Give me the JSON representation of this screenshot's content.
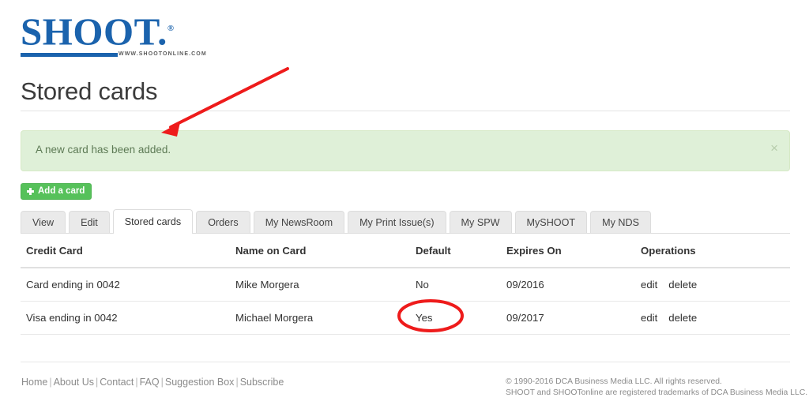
{
  "logo": {
    "wordmark": "SHOOT.",
    "registered_mark": "®",
    "url_text": "WWW.SHOOTONLINE.COM",
    "brand_color": "#1b63ad"
  },
  "page_title": "Stored cards",
  "alert": {
    "message": "A new card has been added.",
    "close_label": "×",
    "background_color": "#dff0d8",
    "border_color": "#d6e9c6",
    "text_color": "#5d7a55"
  },
  "actions": {
    "add_card_label": "Add a card",
    "add_card_icon": "plus-icon",
    "add_card_color": "#56c15a"
  },
  "tabs": [
    {
      "label": "View",
      "active": false
    },
    {
      "label": "Edit",
      "active": false
    },
    {
      "label": "Stored cards",
      "active": true
    },
    {
      "label": "Orders",
      "active": false
    },
    {
      "label": "My NewsRoom",
      "active": false
    },
    {
      "label": "My Print Issue(s)",
      "active": false
    },
    {
      "label": "My SPW",
      "active": false
    },
    {
      "label": "MySHOOT",
      "active": false
    },
    {
      "label": "My NDS",
      "active": false
    }
  ],
  "table": {
    "columns": [
      "Credit Card",
      "Name on Card",
      "Default",
      "Expires On",
      "Operations"
    ],
    "rows": [
      {
        "credit_card": "Card ending in 0042",
        "name_on_card": "Mike Morgera",
        "default": "No",
        "expires_on": "09/2016",
        "edit_label": "edit",
        "delete_label": "delete"
      },
      {
        "credit_card": "Visa ending in 0042",
        "name_on_card": "Michael Morgera",
        "default": "Yes",
        "expires_on": "09/2017",
        "edit_label": "edit",
        "delete_label": "delete"
      }
    ]
  },
  "footer": {
    "links": [
      "Home",
      "About Us",
      "Contact",
      "FAQ",
      "Suggestion Box",
      "Subscribe"
    ],
    "separator": "|",
    "copyright_line1": "© 1990-2016 DCA Business Media LLC. All rights reserved.",
    "copyright_line2": "SHOOT and SHOOTonline are registered trademarks of DCA Business Media LLC."
  },
  "annotations": {
    "arrow_color": "#ee1b1b",
    "ellipse_color": "#ee1b1b",
    "arrow_target": "success-alert",
    "ellipse_target": "default-yes-cell"
  }
}
